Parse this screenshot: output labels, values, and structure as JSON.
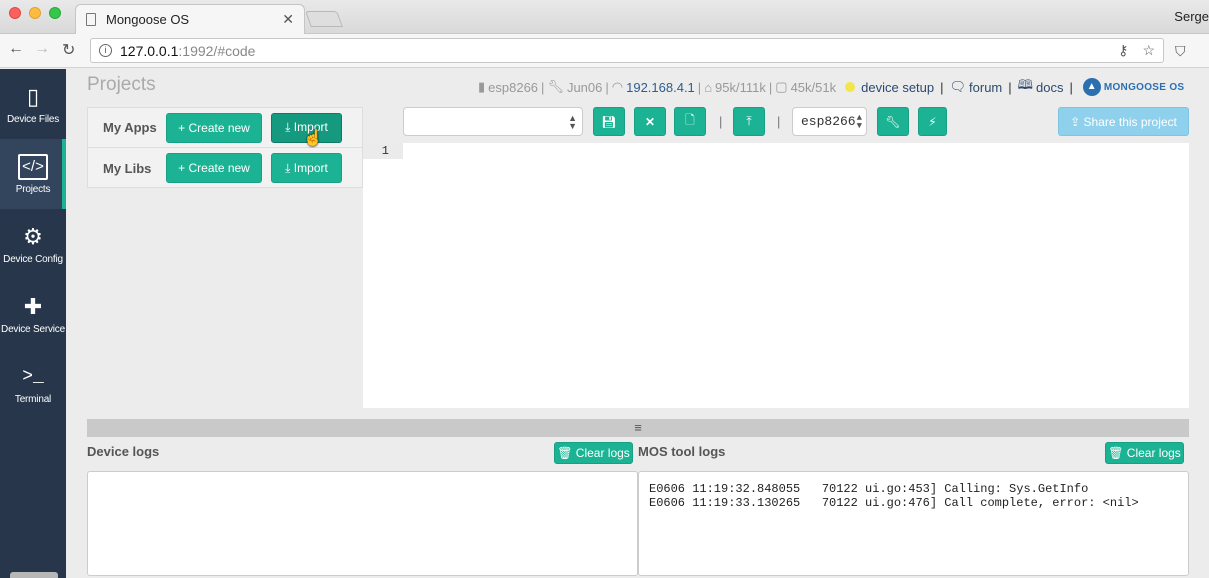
{
  "browser": {
    "tab_title": "Mongoose OS",
    "tab_close": "✕",
    "user": "Serge",
    "url_host": "127.0.0.1",
    "url_path": ":1992/#code"
  },
  "sidebar": {
    "items": [
      {
        "label": "Device Files",
        "icon": "▯"
      },
      {
        "label": "Projects",
        "icon": "</>"
      },
      {
        "label": "Device Config",
        "icon": "⚙"
      },
      {
        "label": "Device Service",
        "icon": "✚"
      },
      {
        "label": "Terminal",
        "icon": ">_"
      }
    ]
  },
  "header": {
    "title": "Projects",
    "status": {
      "device": "esp8266",
      "sep1": "|",
      "build": "Jun06",
      "sep2": "|",
      "ip": "192.168.4.1",
      "sep3": "|",
      "ram": "95k/111k",
      "sep4": "|",
      "flash": "45k/51k",
      "device_setup": "device setup",
      "sep5": "|",
      "forum": "forum",
      "sep6": "|",
      "docs": "docs",
      "sep7": "|",
      "logo_text": "MONGOOSE OS"
    }
  },
  "projects_panel": {
    "my_apps_label": "My Apps",
    "my_libs_label": "My Libs",
    "create_label": "+ Create new",
    "import_label": "⤓ Import"
  },
  "editor_toolbar": {
    "project_value": "",
    "separator": "|",
    "board_value": "esp8266",
    "share_label": "⇪ Share this project"
  },
  "editor": {
    "line_numbers": [
      "1"
    ]
  },
  "splitter_glyph": "≡",
  "logs": {
    "device_title": "Device logs",
    "mos_title": "MOS tool logs",
    "clear_label": "🗑 Clear logs",
    "device_content": "",
    "mos_content": "E0606 11:19:32.848055   70122 ui.go:453] Calling: Sys.GetInfo\nE0606 11:19:33.130265   70122 ui.go:476] Call complete, error: <nil>"
  },
  "colors": {
    "accent": "#1bb394",
    "sidebar_bg": "#27364a",
    "share": "#8fd1ec"
  }
}
